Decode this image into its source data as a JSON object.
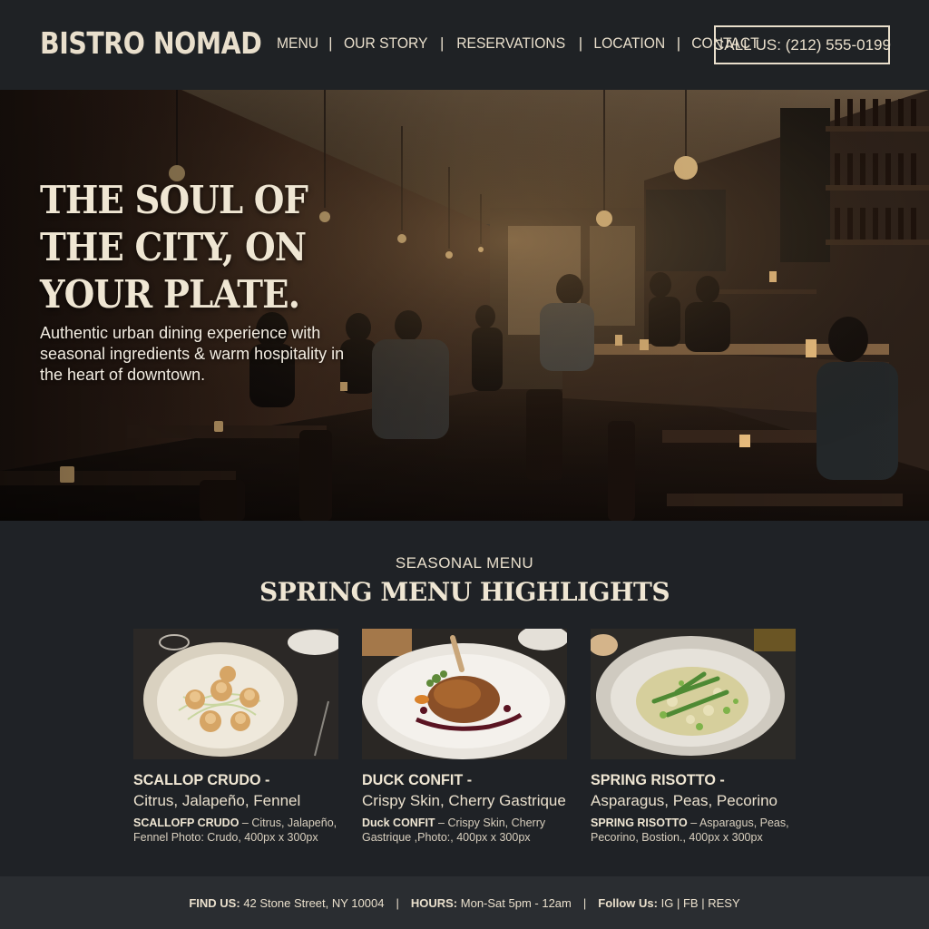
{
  "header": {
    "logo": "BISTRO NOMAD",
    "nav": [
      "MENU",
      "OUR STORY",
      "RESERVATIONS",
      "LOCATION",
      "CONTACT"
    ],
    "nav_separator": "|",
    "call_button": "CALL US: (212) 555-0199"
  },
  "hero": {
    "title": "THE SOUL OF THE CITY, ON YOUR PLATE.",
    "subtitle": "Authentic urban dining experience with seasonal ingredients & warm hospitality in the heart of downtown."
  },
  "menu": {
    "eyebrow": "SEASONAL MENU",
    "title": "SPRING MENU HIGHLIGHTS",
    "cards": [
      {
        "name": "SCALLOP CRUDO -",
        "desc": "Citrus, Jalapeño, Fennel",
        "caption_bold": "SCALLOFP CRUDO",
        "caption_rest": " – Citrus, Jalapeño, Fennel Photo: Crudo, 400px x 300px",
        "icon": "scallop-plate"
      },
      {
        "name": "DUCK CONFIT -",
        "desc": "Crispy Skin, Cherry Gastrique",
        "caption_bold": "Duck CONFIT",
        "caption_rest": " – Crispy Skin, Cherry Gastrique ,Photo:, 400px x 300px",
        "icon": "duck-plate"
      },
      {
        "name": "SPRING RISOTTO -",
        "desc": "Asparagus, Peas, Pecorino",
        "caption_bold": "SPRING RISOTTO",
        "caption_rest": " – Asparagus, Peas, Pecorino, Bostion., 400px x 300px",
        "icon": "risotto-plate"
      }
    ]
  },
  "footer": {
    "find_label": "FIND US:",
    "find_value": "42 Stone Street, NY 10004",
    "hours_label": "HOURS:",
    "hours_value": "Mon-Sat 5pm - 12am",
    "follow_label": "Follow Us:",
    "socials": [
      "IG",
      "FB",
      "RESY"
    ],
    "separator": "|"
  },
  "colors": {
    "background": "#1f2226",
    "cream_text": "#e9dfcc",
    "footer_bg": "#2a2d31"
  }
}
